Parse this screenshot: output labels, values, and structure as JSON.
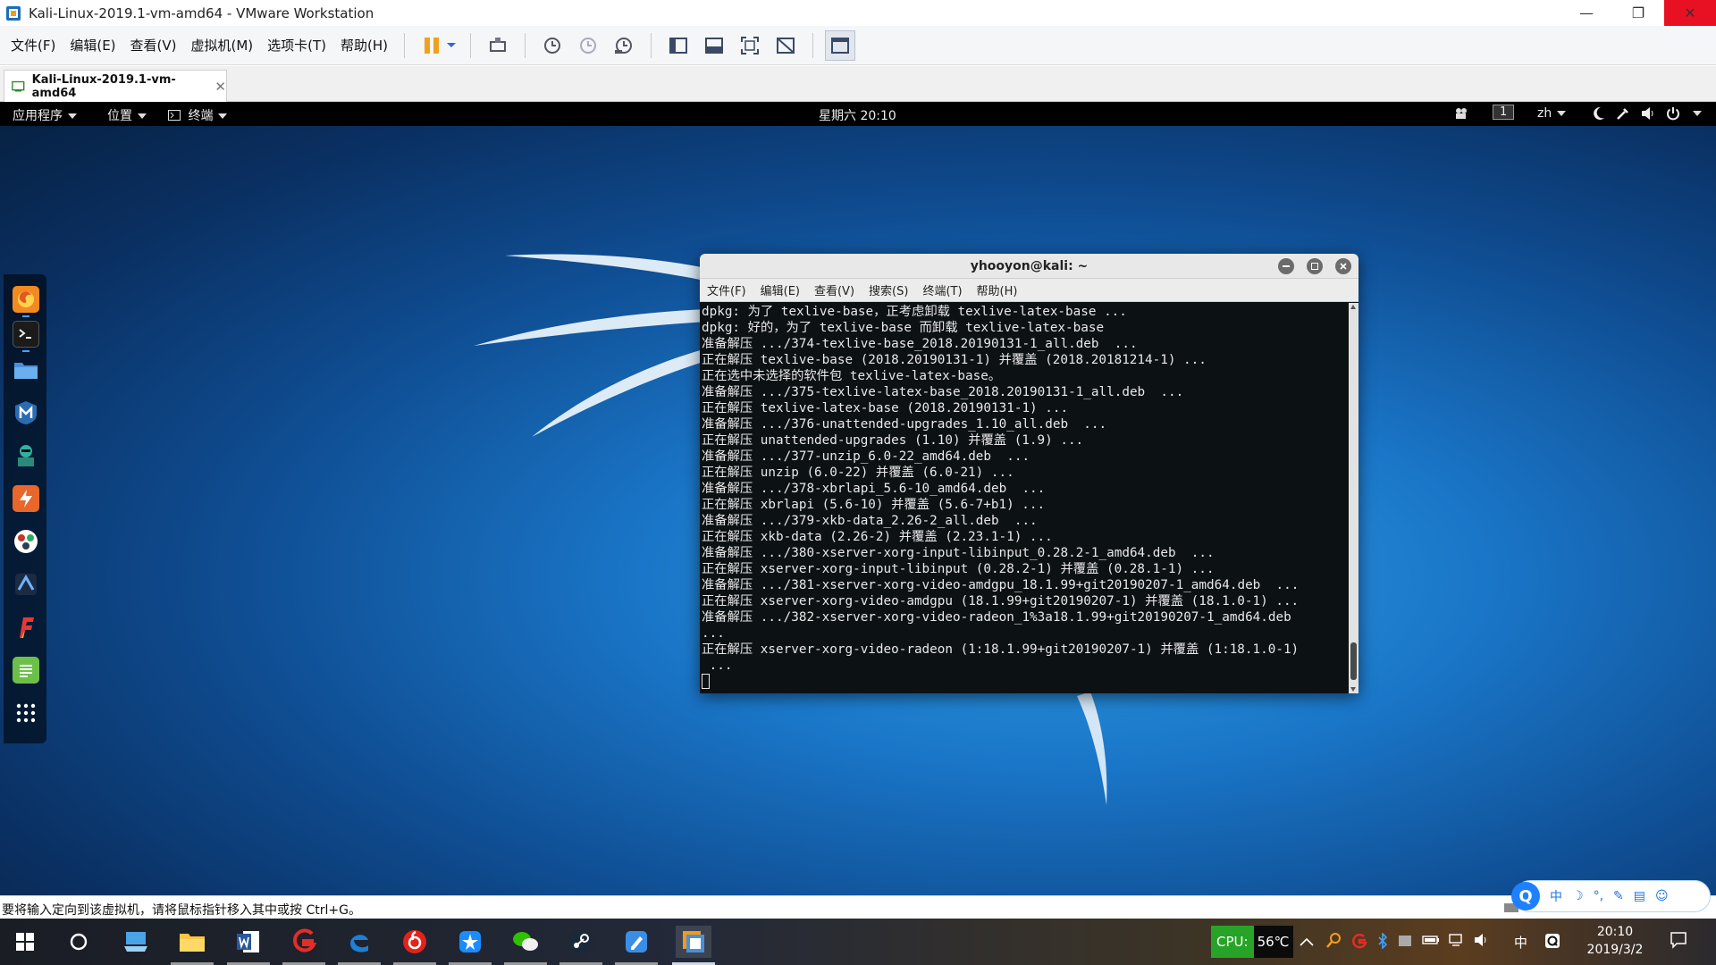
{
  "window": {
    "title": "Kali-Linux-2019.1-vm-amd64 - VMware Workstation",
    "close_glyph": "✕",
    "min_glyph": "—",
    "max_glyph": "❐"
  },
  "menubar": [
    "文件(F)",
    "编辑(E)",
    "查看(V)",
    "虚拟机(M)",
    "选项卡(T)",
    "帮助(H)"
  ],
  "tab": {
    "label": "Kali-Linux-2019.1-vm-amd64",
    "close": "✕"
  },
  "gnome": {
    "apps": "应用程序",
    "places": "位置",
    "terminal": "终端",
    "clock": "星期六 20:10",
    "workspace": "1",
    "lang": "zh"
  },
  "terminal": {
    "title": "yhooyon@kali: ~",
    "menu": [
      "文件(F)",
      "编辑(E)",
      "查看(V)",
      "搜索(S)",
      "终端(T)",
      "帮助(H)"
    ],
    "lines": [
      "dpkg: 为了 texlive-base，正考虑卸载 texlive-latex-base ...",
      "dpkg: 好的，为了 texlive-base 而卸载 texlive-latex-base",
      "准备解压 .../374-texlive-base_2018.20190131-1_all.deb  ...",
      "正在解压 texlive-base (2018.20190131-1) 并覆盖 (2018.20181214-1) ...",
      "正在选中未选择的软件包 texlive-latex-base。",
      "准备解压 .../375-texlive-latex-base_2018.20190131-1_all.deb  ...",
      "正在解压 texlive-latex-base (2018.20190131-1) ...",
      "准备解压 .../376-unattended-upgrades_1.10_all.deb  ...",
      "正在解压 unattended-upgrades (1.10) 并覆盖 (1.9) ...",
      "准备解压 .../377-unzip_6.0-22_amd64.deb  ...",
      "正在解压 unzip (6.0-22) 并覆盖 (6.0-21) ...",
      "准备解压 .../378-xbrlapi_5.6-10_amd64.deb  ...",
      "正在解压 xbrlapi (5.6-10) 并覆盖 (5.6-7+b1) ...",
      "准备解压 .../379-xkb-data_2.26-2_all.deb  ...",
      "正在解压 xkb-data (2.26-2) 并覆盖 (2.23.1-1) ...",
      "准备解压 .../380-xserver-xorg-input-libinput_0.28.2-1_amd64.deb  ...",
      "正在解压 xserver-xorg-input-libinput (0.28.2-1) 并覆盖 (0.28.1-1) ...",
      "准备解压 .../381-xserver-xorg-video-amdgpu_18.1.99+git20190207-1_amd64.deb  ...",
      "正在解压 xserver-xorg-video-amdgpu (18.1.99+git20190207-1) 并覆盖 (18.1.0-1) ...",
      "准备解压 .../382-xserver-xorg-video-radeon_1%3a18.1.99+git20190207-1_amd64.deb",
      "...",
      "正在解压 xserver-xorg-video-radeon (1:18.1.99+git20190207-1) 并覆盖 (1:18.1.0-1)",
      " ..."
    ]
  },
  "status": {
    "message": "要将输入定向到该虚拟机，请将鼠标指针移入其中或按 Ctrl+G。"
  },
  "ime": {
    "items": [
      "中",
      "☽",
      "°,",
      "✎",
      "▤",
      "☺"
    ]
  },
  "taskbar": {
    "cpu_label": "CPU:",
    "cpu_value": "56℃",
    "ime_char": "中",
    "time": "20:10",
    "date": "2019/3/2"
  }
}
